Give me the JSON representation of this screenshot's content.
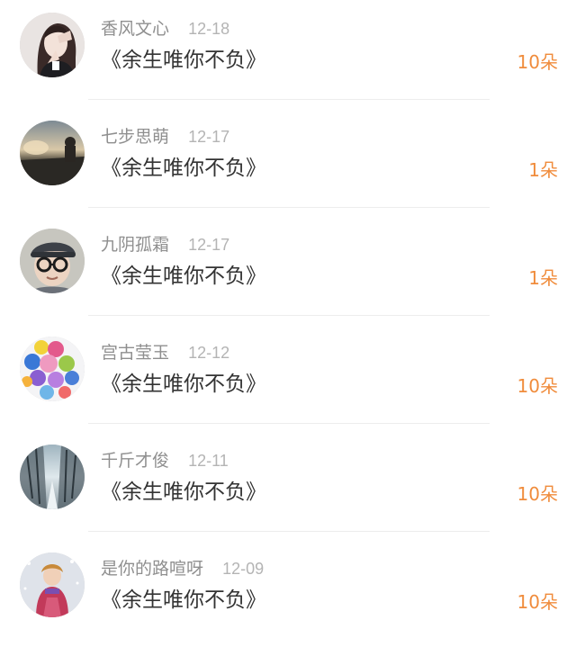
{
  "colors": {
    "username": "#8f8f8f",
    "date": "#b4b4b4",
    "title": "#333333",
    "count_accent": "#f08c3c",
    "divider": "#ededed"
  },
  "rows": [
    {
      "username": "香风文心",
      "date": "12-18",
      "title": "《余生唯你不负》",
      "count": "10朵",
      "avatar_icon": "girl-portrait-avatar"
    },
    {
      "username": "七步思萌",
      "date": "12-17",
      "title": "《余生唯你不负》",
      "count": "1朵",
      "avatar_icon": "sunset-landscape-avatar"
    },
    {
      "username": "九阴孤霜",
      "date": "12-17",
      "title": "《余生唯你不负》",
      "count": "1朵",
      "avatar_icon": "child-with-glasses-avatar"
    },
    {
      "username": "宫古莹玉",
      "date": "12-12",
      "title": "《余生唯你不负》",
      "count": "10朵",
      "avatar_icon": "balloons-avatar"
    },
    {
      "username": "千斤才俊",
      "date": "12-11",
      "title": "《余生唯你不负》",
      "count": "10朵",
      "avatar_icon": "snowy-forest-avatar"
    },
    {
      "username": "是你的路喧呀",
      "date": "12-09",
      "title": "《余生唯你不负》",
      "count": "10朵",
      "avatar_icon": "child-in-snow-avatar"
    }
  ]
}
